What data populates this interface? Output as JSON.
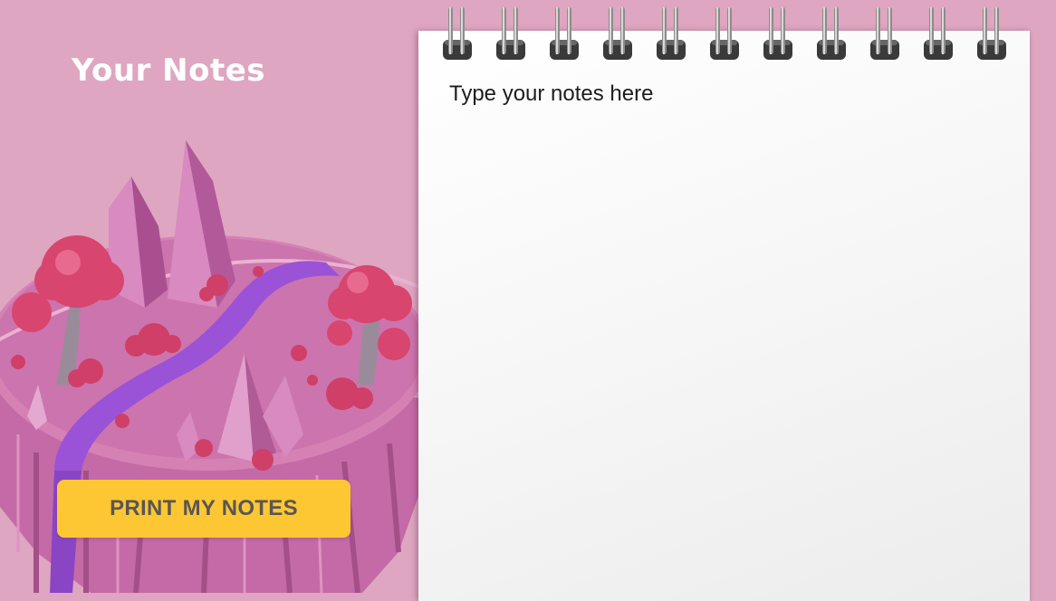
{
  "header": {
    "title": "Your Notes"
  },
  "actions": {
    "print_label": "PRINT MY NOTES"
  },
  "notes": {
    "placeholder": "Type your notes here",
    "value": ""
  },
  "colors": {
    "background": "#dea6c0",
    "button": "#fdc734",
    "button_text": "#5a5654",
    "paper": "#f7f7f7"
  },
  "illustration": {
    "icon": "floating-island-illustration"
  }
}
